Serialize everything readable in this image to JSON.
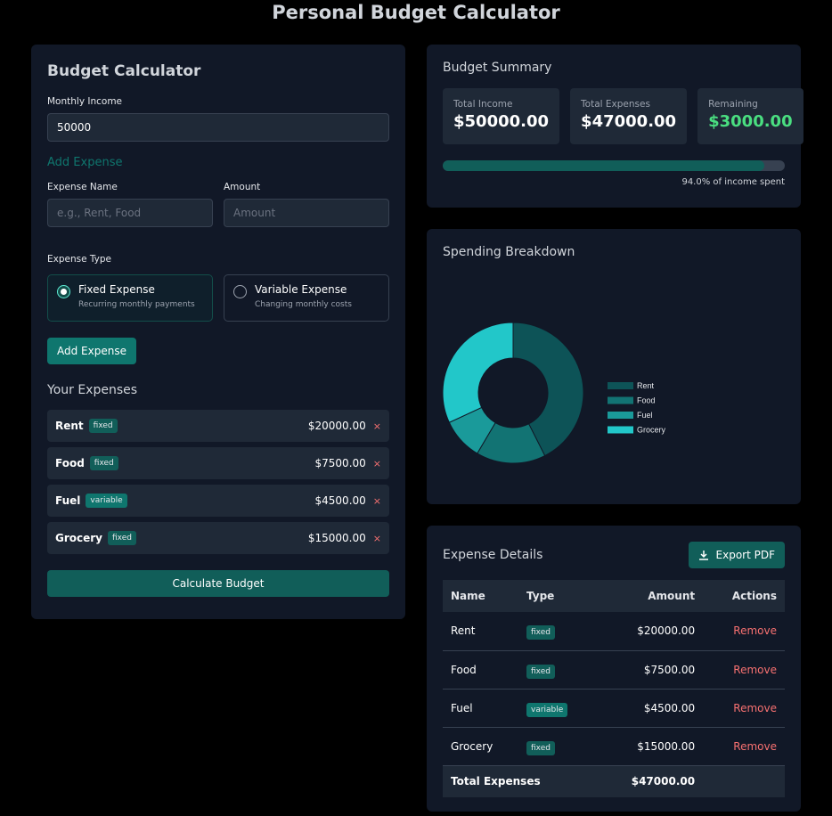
{
  "page_title": "Personal Budget Calculator",
  "calculator": {
    "title": "Budget Calculator",
    "income_label": "Monthly Income",
    "income_value": "50000",
    "add_heading": "Add Expense",
    "name_label": "Expense Name",
    "name_placeholder": "e.g., Rent, Food",
    "amount_label": "Amount",
    "amount_placeholder": "Amount",
    "type_label": "Expense Type",
    "fixed": {
      "title": "Fixed Expense",
      "sub": "Recurring monthly payments",
      "selected": true
    },
    "variable": {
      "title": "Variable Expense",
      "sub": "Changing monthly costs",
      "selected": false
    },
    "add_button": "Add Expense",
    "list_heading": "Your Expenses",
    "remove_glyph": "×",
    "calc_button": "Calculate Budget"
  },
  "expenses": [
    {
      "name": "Rent",
      "type": "fixed",
      "amount": "$20000.00",
      "value": 20000
    },
    {
      "name": "Food",
      "type": "fixed",
      "amount": "$7500.00",
      "value": 7500
    },
    {
      "name": "Fuel",
      "type": "variable",
      "amount": "$4500.00",
      "value": 4500
    },
    {
      "name": "Grocery",
      "type": "fixed",
      "amount": "$15000.00",
      "value": 15000
    }
  ],
  "summary": {
    "title": "Budget Summary",
    "income_label": "Total Income",
    "income": "$50000.00",
    "expenses_label": "Total Expenses",
    "expenses": "$47000.00",
    "remaining_label": "Remaining",
    "remaining": "$3000.00",
    "spent_percent": 94.0,
    "spent_text": "94.0% of income spent",
    "remaining_color": "#4ade80"
  },
  "chart_data": {
    "type": "pie",
    "variant": "doughnut",
    "title": "Spending Breakdown",
    "categories": [
      "Rent",
      "Food",
      "Fuel",
      "Grocery"
    ],
    "values": [
      20000,
      7500,
      4500,
      15000
    ],
    "colors": [
      "#0d5357",
      "#127373",
      "#1a9a9a",
      "#22c7c9"
    ],
    "legend": "right"
  },
  "details": {
    "title": "Expense Details",
    "export_label": "Export PDF",
    "headers": [
      "Name",
      "Type",
      "Amount",
      "Actions"
    ],
    "remove_label": "Remove",
    "total_label": "Total Expenses",
    "total": "$47000.00"
  }
}
